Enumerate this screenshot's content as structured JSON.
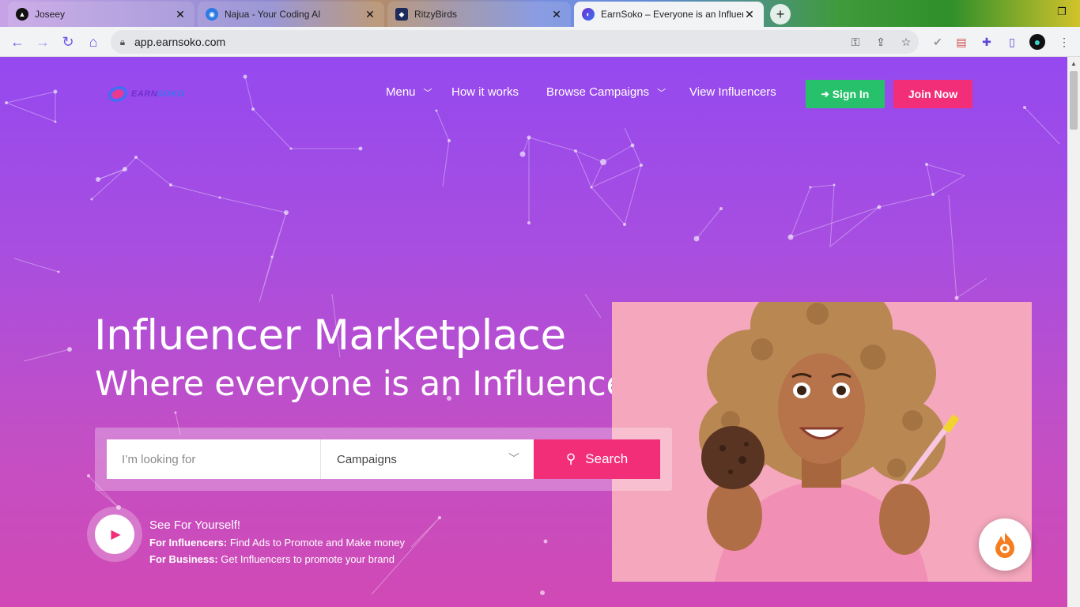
{
  "browser": {
    "tabs": [
      {
        "title": "Joseey",
        "favicon": "triangle-logo-icon"
      },
      {
        "title": "Najua - Your Coding AI",
        "favicon": "eye-logo-icon"
      },
      {
        "title": "RitzyBirds",
        "favicon": "bird-logo-icon"
      },
      {
        "title": "EarnSoko – Everyone is an Influencer",
        "favicon": "earnsoko-logo-icon"
      }
    ],
    "url": "app.earnsoko.com"
  },
  "site": {
    "logo_a": "EARN",
    "logo_b": "SOKO",
    "nav": {
      "menu": "Menu",
      "how": "How it works",
      "browse": "Browse Campaigns",
      "influencers": "View Influencers"
    },
    "signin": "Sign In",
    "join": "Join Now",
    "colors": {
      "primary": "#9549ef",
      "accent": "#f22e79",
      "green": "#27c16b"
    }
  },
  "hero": {
    "title": "Influencer Marketplace",
    "subtitle": "Where everyone is an Influencer"
  },
  "search": {
    "placeholder": "I’m looking for",
    "category": "Campaigns",
    "button": "Search"
  },
  "promo": {
    "heading": "See For Yourself!",
    "l1_bold": "For Influencers:",
    "l1_text": " Find Ads to Promote and Make money",
    "l2_bold": "For Business:",
    "l2_text": " Get Influencers to promote your brand"
  }
}
